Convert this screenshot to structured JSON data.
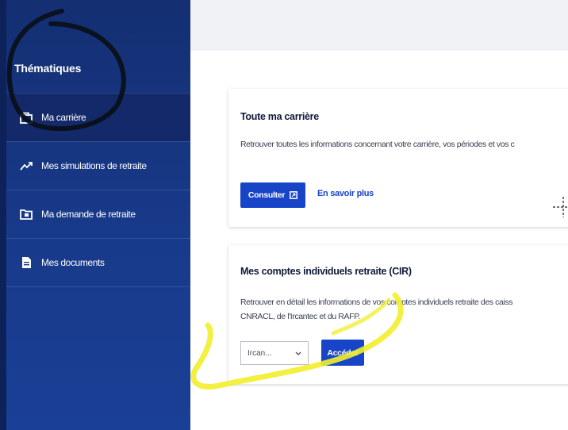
{
  "sidebar": {
    "heading": "Thématiques",
    "items": [
      {
        "label": "Ma carrière",
        "icon": "briefcase-icon"
      },
      {
        "label": "Mes simulations de retraite",
        "icon": "trend-chart-icon"
      },
      {
        "label": "Ma demande de retraite",
        "icon": "folder-icon"
      },
      {
        "label": "Mes documents",
        "icon": "document-icon"
      }
    ]
  },
  "cards": [
    {
      "title": "Toute ma carrière",
      "text": "Retrouver toutes les informations concernant votre carrière, vos périodes et vos c",
      "button_label": "Consulter",
      "button_icon": "external-link-icon",
      "link_label": "En savoir plus"
    },
    {
      "title": "Mes comptes individuels retraite (CIR)",
      "text": "Retrouver en détail les informations de vos comptes individuels retraite des caiss",
      "text_line2": "CNRACL, de l'Ircantec et du RAFP.",
      "select_value": "Ircan...",
      "button_label": "Accéder"
    }
  ],
  "colors": {
    "sidebar": "#183a8a",
    "primary": "#1845c7",
    "highlight_yellow": "#f2ee2e"
  }
}
